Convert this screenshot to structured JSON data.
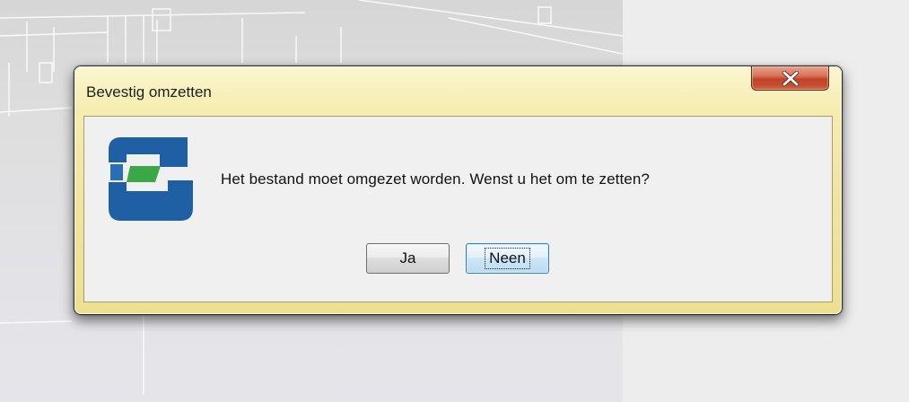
{
  "dialog": {
    "title": "Bevestig omzetten",
    "message": "Het bestand moet omgezet worden. Wenst u het om te zetten?",
    "buttons": {
      "yes_label": "Ja",
      "no_label": "Neen"
    },
    "close_icon": "close-x-icon",
    "app_icon": "application-logo-icon",
    "focused_button": "Neen"
  },
  "colors": {
    "title_bar": "#f2e6a2",
    "close_button": "#c94a30",
    "logo_blue": "#1f5fa3",
    "logo_green": "#3aa845",
    "client_background": "#f0f0f0"
  }
}
